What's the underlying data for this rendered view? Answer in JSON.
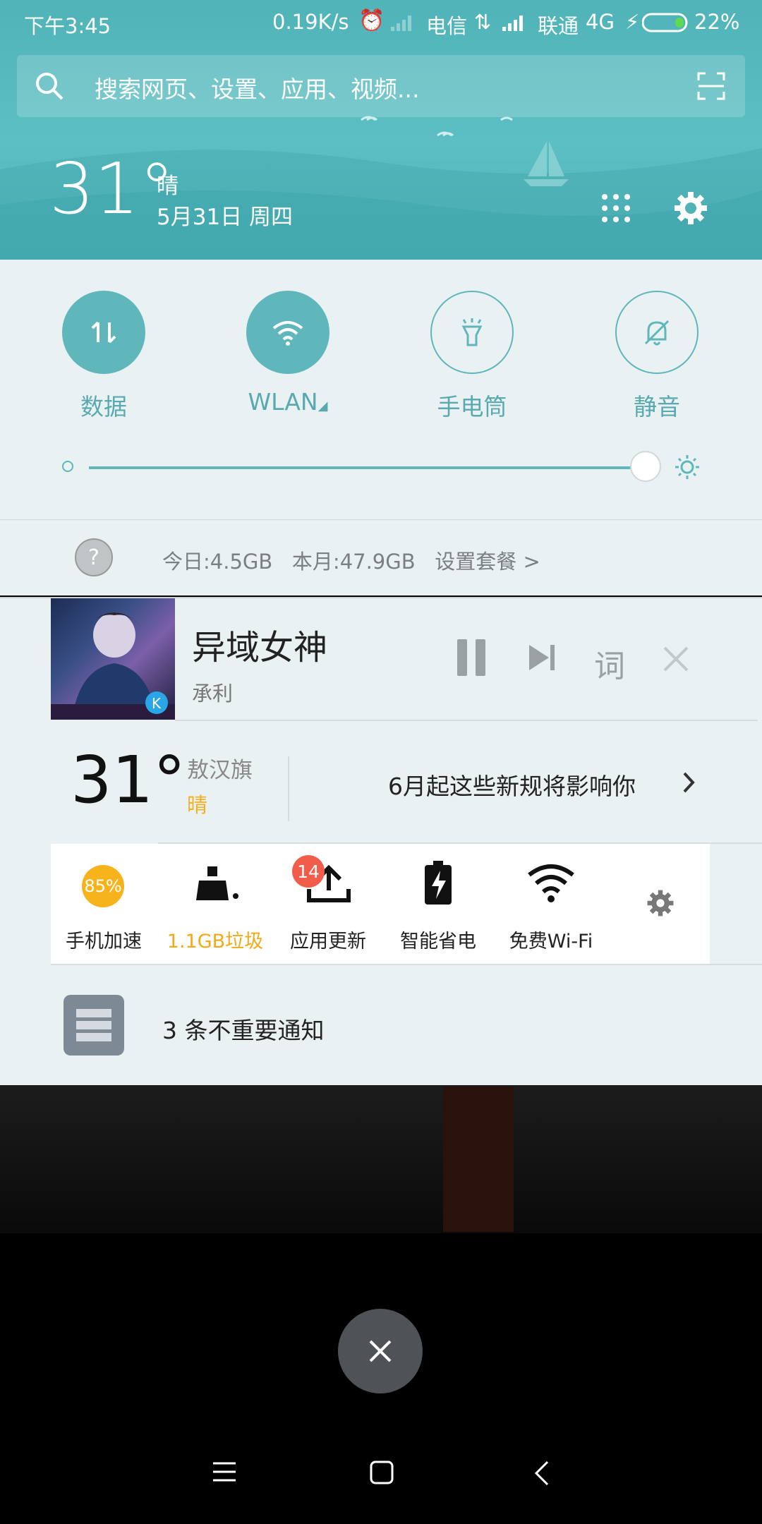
{
  "status_bar": {
    "time": "下午3:45",
    "speed": "0.19K/s",
    "carrier1": "电信",
    "carrier2": "联通",
    "network": "4G",
    "battery": "22%"
  },
  "search": {
    "placeholder": "搜索网页、设置、应用、视频..."
  },
  "header_weather": {
    "temp": "31°",
    "condition": "晴",
    "date": "5月31日 周四"
  },
  "quick_settings": {
    "toggles": [
      {
        "label": "数据",
        "state": "on"
      },
      {
        "label": "WLAN",
        "state": "on"
      },
      {
        "label": "手电筒",
        "state": "off"
      },
      {
        "label": "静音",
        "state": "off"
      }
    ],
    "brightness_level": 0.95
  },
  "data_usage": {
    "today": "今日:4.5GB",
    "month": "本月:47.9GB",
    "action": "设置套餐 >"
  },
  "music": {
    "title": "异域女神",
    "artist": "承利",
    "lyric_label": "词"
  },
  "weather_card": {
    "temp": "31°",
    "city": "敖汉旗",
    "condition": "晴",
    "headline": "6月起这些新规将影响你"
  },
  "tools": {
    "items": [
      {
        "label": "手机加速",
        "value": "85%",
        "icon": "speed-badge"
      },
      {
        "label": "1.1GB垃圾",
        "icon": "cleaner-icon"
      },
      {
        "label": "应用更新",
        "icon": "upload-icon",
        "badge": "14"
      },
      {
        "label": "智能省电",
        "icon": "battery-icon"
      },
      {
        "label": "免费Wi-Fi",
        "icon": "wifi-icon"
      }
    ]
  },
  "unimportant": {
    "label": "3 条不重要通知"
  },
  "colors": {
    "accent": "#5fb7bb",
    "warning": "#f4b020",
    "badge": "#f25c4a"
  }
}
